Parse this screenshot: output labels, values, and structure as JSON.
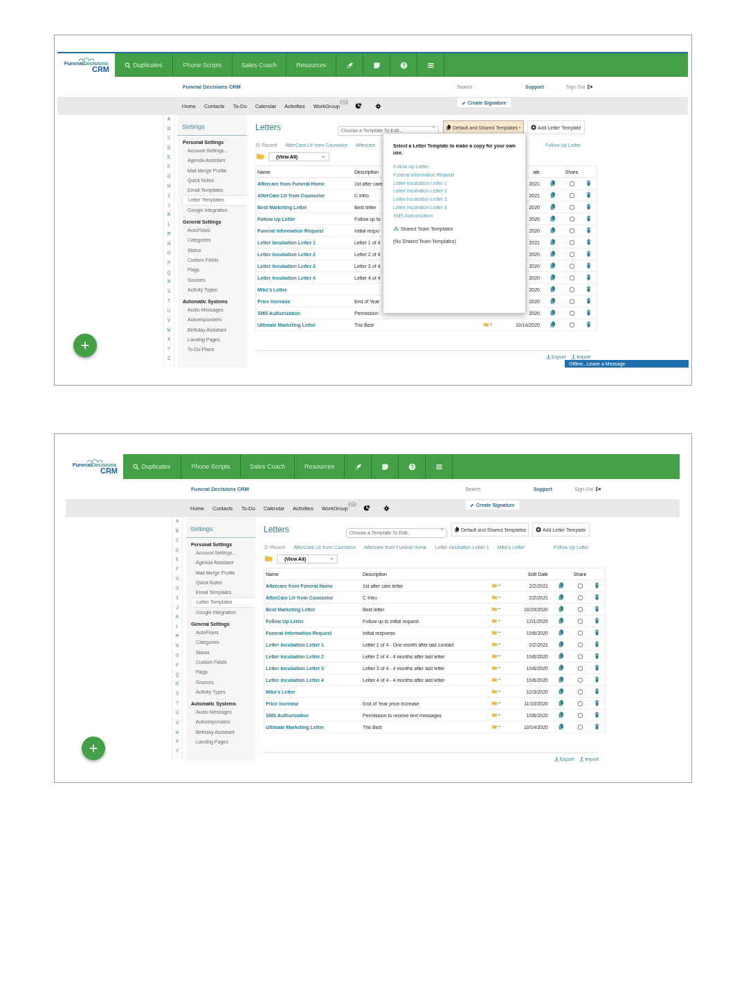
{
  "screenshots": [
    {
      "logo": {
        "name_first": "Funeral",
        "name_second": "Decisions",
        "product": "CRM"
      },
      "nav": [
        {
          "label": "Duplicates",
          "kind": "search"
        },
        {
          "label": "Phone Scripts",
          "kind": "text"
        },
        {
          "label": "Sales Coach",
          "kind": "text"
        },
        {
          "label": "Resources",
          "kind": "text"
        }
      ],
      "header": {
        "brand": "Funeral Decisions CRM",
        "search": {
          "placeholder": "Search"
        },
        "support": "Support",
        "sign_out": "Sign Out"
      },
      "menu": [
        "Home",
        "Contacts",
        "To-Do",
        "Calendar",
        "Activities",
        "WorkGroup"
      ],
      "workgroup_badge": "27",
      "create_signature": "Create Signature",
      "alphabet": [
        "A",
        "B",
        "C",
        "D",
        "E",
        "F",
        "G",
        "H",
        "I",
        "J",
        "K",
        "L",
        "M",
        "N",
        "O",
        "P",
        "Q",
        "R",
        "S",
        "T",
        "U",
        "V",
        "W",
        "X",
        "Y",
        "Z"
      ],
      "sidebar": {
        "title": "Settings",
        "groups": [
          {
            "title": "Personal Settings",
            "items": [
              {
                "label": "Account Settings...",
                "selected": false
              },
              {
                "label": "Agenda Assistant",
                "selected": false
              },
              {
                "label": "Mail Merge Profile",
                "selected": false
              },
              {
                "label": "Quick Notes",
                "selected": false
              },
              {
                "label": "Email Templates",
                "selected": false
              },
              {
                "label": "Letter Templates",
                "selected": true
              },
              {
                "label": "Google Integration",
                "selected": false
              }
            ]
          },
          {
            "title": "General Settings",
            "items": [
              {
                "label": "AutoFlows",
                "selected": false
              },
              {
                "label": "Categories",
                "selected": false
              },
              {
                "label": "Status",
                "selected": false
              },
              {
                "label": "Custom Fields",
                "selected": false
              },
              {
                "label": "Flags",
                "selected": false
              },
              {
                "label": "Sources",
                "selected": false
              },
              {
                "label": "Activity Types",
                "selected": false
              }
            ]
          },
          {
            "title": "Automatic Systems",
            "items": [
              {
                "label": "Audio Messages",
                "selected": false
              },
              {
                "label": "Autoresponders",
                "selected": false
              },
              {
                "label": "Birthday Assistant",
                "selected": false
              },
              {
                "label": "Landing Pages",
                "selected": false
              },
              {
                "label": "To-Do Plans",
                "selected": false
              }
            ]
          }
        ]
      },
      "letters": {
        "title": "Letters",
        "template_select": {
          "placeholder": "Choose a Template To Edit..."
        },
        "default_button": {
          "label": "Default and Shared Templates",
          "open": true
        },
        "add_button": "Add Letter Template",
        "recent_label": "Recent",
        "recent": [
          "AfterCare Ltr from Counselor",
          "Aftercare",
          "Follow Up Letter"
        ],
        "folder_filter": "(View All)",
        "columns": [
          "Name",
          "Description",
          "",
          "ate",
          "",
          "Share",
          ""
        ],
        "rows": [
          {
            "name": "Aftercare from Funeral Home",
            "description": "1st after care",
            "date": "2021",
            "shared": false
          },
          {
            "name": "AfterCare Ltr from Counselor",
            "description": "C Intro",
            "date": "2021",
            "shared": false
          },
          {
            "name": "Best Marketing Letter",
            "description": "Best letter",
            "date": "2020",
            "shared": false
          },
          {
            "name": "Follow Up Letter",
            "description": "Follow up to",
            "date": "2020",
            "shared": false
          },
          {
            "name": "Funeral Information Request",
            "description": "Initial respo",
            "date": "2020",
            "shared": false
          },
          {
            "name": "Letter Incubation Letter 1",
            "description": "Letter 1 of 4",
            "date": "2021",
            "shared": false
          },
          {
            "name": "Letter Incubation Letter 2",
            "description": "Letter 2 of 4",
            "date": "2020",
            "shared": false
          },
          {
            "name": "Letter Incubation Letter 3",
            "description": "Letter 3 of 4",
            "date": "2020",
            "shared": false
          },
          {
            "name": "Letter Incubation Letter 4",
            "description": "Letter 4 of 4",
            "date": "2020",
            "shared": false
          },
          {
            "name": "Mike's Letter",
            "description": "",
            "date": "2020",
            "shared": false
          },
          {
            "name": "Price Increase",
            "description": "End of Year",
            "date": "2020",
            "shared": false
          },
          {
            "name": "SMS Authorization",
            "description": "Permission",
            "date": "2020",
            "shared": false
          },
          {
            "name": "Ultimate Marketing Letter",
            "description": "The Best",
            "date": "10/14/2020",
            "folder_menu": true,
            "shared": false
          }
        ],
        "export": "Export",
        "import": "Import"
      },
      "template_popup": {
        "heading": "Select a Letter Template to make a copy for your own use.",
        "templates": [
          "Follow Up Letter",
          "Funeral Information Request",
          "Letter Incubation Letter 1",
          "Letter Incubation Letter 2",
          "Letter Incubation Letter 3",
          "Letter Incubation Letter 4",
          "SMS Authorization"
        ],
        "shared_heading": "Shared Team Templates",
        "shared_empty": "(No Shared Team Templates)"
      },
      "offline_chat": "Offline...Leave a Message"
    },
    {
      "logo": {
        "name_first": "Funeral",
        "name_second": "Decisions",
        "product": "CRM"
      },
      "nav": [
        {
          "label": "Duplicates",
          "kind": "search"
        },
        {
          "label": "Phone Scripts",
          "kind": "text"
        },
        {
          "label": "Sales Coach",
          "kind": "text"
        },
        {
          "label": "Resources",
          "kind": "text"
        }
      ],
      "header": {
        "brand": "Funeral Decisions CRM",
        "search": {
          "placeholder": "Search"
        },
        "support": "Support",
        "sign_out": "Sign Out"
      },
      "menu": [
        "Home",
        "Contacts",
        "To-Do",
        "Calendar",
        "Activities",
        "WorkGroup"
      ],
      "workgroup_badge": "27",
      "create_signature": "Create Signature",
      "alphabet": [
        "A",
        "B",
        "C",
        "D",
        "E",
        "F",
        "G",
        "H",
        "I",
        "J",
        "K",
        "L",
        "M",
        "N",
        "O",
        "P",
        "Q",
        "R",
        "S",
        "T",
        "U",
        "V",
        "W",
        "X",
        "Y"
      ],
      "sidebar": {
        "title": "Settings",
        "groups": [
          {
            "title": "Personal Settings",
            "items": [
              {
                "label": "Account Settings...",
                "selected": false
              },
              {
                "label": "Agenda Assistant",
                "selected": false
              },
              {
                "label": "Mail Merge Profile",
                "selected": false
              },
              {
                "label": "Quick Notes",
                "selected": false
              },
              {
                "label": "Email Templates",
                "selected": false
              },
              {
                "label": "Letter Templates",
                "selected": true
              },
              {
                "label": "Google Integration",
                "selected": false
              }
            ]
          },
          {
            "title": "General Settings",
            "items": [
              {
                "label": "AutoFlows",
                "selected": false
              },
              {
                "label": "Categories",
                "selected": false
              },
              {
                "label": "Status",
                "selected": false
              },
              {
                "label": "Custom Fields",
                "selected": false
              },
              {
                "label": "Flags",
                "selected": false
              },
              {
                "label": "Sources",
                "selected": false
              },
              {
                "label": "Activity Types",
                "selected": false
              }
            ]
          },
          {
            "title": "Automatic Systems",
            "items": [
              {
                "label": "Audio Messages",
                "selected": false
              },
              {
                "label": "Autoresponders",
                "selected": false
              },
              {
                "label": "Birthday Assistant",
                "selected": false
              },
              {
                "label": "Landing Pages",
                "selected": false
              }
            ]
          }
        ]
      },
      "letters": {
        "title": "Letters",
        "template_select": {
          "placeholder": "Choose a Template To Edit.."
        },
        "default_button": {
          "label": "Default and Shared Templates",
          "open": false
        },
        "add_button": "Add Letter Template",
        "recent_label": "Recent",
        "recent": [
          "AfterCare Ltr from Counselor",
          "Aftercare from Funeral Home",
          "Letter Incubation Letter 1",
          "Mike's Letter",
          "Follow Up Letter"
        ],
        "folder_filter": "(View All)",
        "columns": [
          "Name",
          "Description",
          "",
          "Edit Date",
          "",
          "Share",
          ""
        ],
        "rows": [
          {
            "name": "Aftercare from Funeral Home",
            "description": "1st after care letter",
            "date": "2/2/2021",
            "folder_menu": true,
            "shared": false
          },
          {
            "name": "AfterCare Ltr from Counselor",
            "description": "C Intro",
            "date": "2/2/2021",
            "folder_menu": true,
            "shared": false
          },
          {
            "name": "Best Marketing Letter",
            "description": "Best letter",
            "date": "10/29/2020",
            "folder_menu": true,
            "shared": false
          },
          {
            "name": "Follow Up Letter",
            "description": "Follow up to initial request",
            "date": "12/1/2020",
            "folder_menu": true,
            "shared": false
          },
          {
            "name": "Funeral Information Request",
            "description": "Initial response",
            "date": "10/6/2020",
            "folder_menu": true,
            "shared": false
          },
          {
            "name": "Letter Incubation Letter 1",
            "description": "Letter 1 of 4 - One month after last contact",
            "date": "2/2/2021",
            "folder_menu": true,
            "shared": false
          },
          {
            "name": "Letter Incubation Letter 2",
            "description": "Letter 2 of 4 - 4 months after last letter",
            "date": "10/6/2020",
            "folder_menu": true,
            "shared": false
          },
          {
            "name": "Letter Incubation Letter 3",
            "description": "Letter 3 of 4 - 4 months after last letter",
            "date": "10/6/2020",
            "folder_menu": true,
            "shared": false
          },
          {
            "name": "Letter Incubation Letter 4",
            "description": "Letter 4 of 4 - 4 months after last letter",
            "date": "10/6/2020",
            "folder_menu": true,
            "shared": false
          },
          {
            "name": "Mike's Letter",
            "description": "",
            "date": "12/3/2020",
            "folder_menu": true,
            "shared": false
          },
          {
            "name": "Price Increase",
            "description": "End of Year price increase",
            "date": "11/10/2020",
            "folder_menu": true,
            "shared": false
          },
          {
            "name": "SMS Authorization",
            "description": "Permission to receive text messages",
            "date": "10/6/2020",
            "folder_menu": true,
            "shared": false
          },
          {
            "name": "Ultimate Marketing Letter",
            "description": "The Best",
            "date": "10/14/2020",
            "folder_menu": true,
            "shared": false
          }
        ],
        "export": "Export",
        "import": "Import"
      }
    }
  ]
}
